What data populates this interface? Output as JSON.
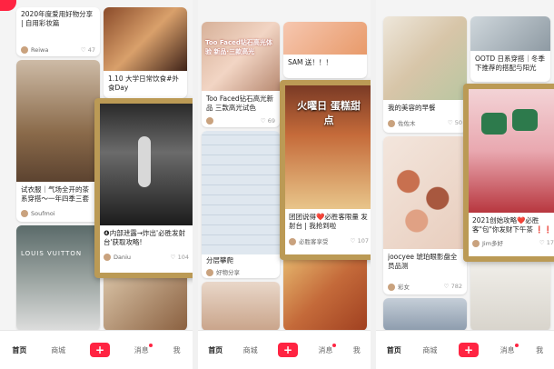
{
  "phone1": {
    "cards": [
      {
        "title": "2020年度爱用好物分享 | 自用彩妆篇",
        "user": "Reiwa",
        "likes": "47"
      },
      {
        "title": "1.10 大学日常饮食#外食Day",
        "user": "",
        "likes": ""
      },
      {
        "title": "试衣服｜气场全开的茶系穿搭～一年四季三套",
        "user": "Soufmoi",
        "likes": ""
      },
      {
        "title": "LOUIS VUITTON",
        "user": "",
        "likes": ""
      }
    ],
    "featured": {
      "title": "❹内部泄露→炸出'必胜发射台'获取攻略!",
      "user": "Daniu",
      "likes": "104"
    },
    "tabbar": {
      "home": "首页",
      "mall": "商城",
      "plus": "+",
      "msg": "消息",
      "me": "我"
    }
  },
  "phone2": {
    "cards": [
      {
        "title": "Too Faced钻石高光体验 新品·三款高光",
        "user": "",
        "likes": "69"
      },
      {
        "title": "Too Faced钻石高光新品 三款高光试色",
        "user": "",
        "likes": "69"
      },
      {
        "title": "SAM 送！！！",
        "user": "",
        "likes": ""
      },
      {
        "title": "分层攀爬",
        "user": "好物分享",
        "likes": ""
      }
    ],
    "featured": {
      "banner": "火曜日 蛋糕甜点",
      "title": "团团说得❤️必胜客限量 发射台 | 我抢到啦",
      "user": "必胜客享受",
      "likes": "107"
    },
    "tabbar": {
      "home": "首页",
      "mall": "商城",
      "plus": "+",
      "msg": "消息",
      "me": "我"
    }
  },
  "phone3": {
    "cards": [
      {
        "title": "我的美容的早餐",
        "user": "佐佐木",
        "likes": "50"
      },
      {
        "title": "joocyee 琥珀眼影盘全员品测",
        "user": "彩女",
        "likes": "782"
      },
      {
        "title": "OOTD 日系穿搭｜冬季下推荐的搭配与阳光",
        "user": "",
        "likes": ""
      }
    ],
    "featured": {
      "title": "2021创始攻略❤️必胜客\"包\"你发财下午茶 ❗❗",
      "user": "Jim多好",
      "likes": "17"
    },
    "tabbar": {
      "home": "首页",
      "mall": "商城",
      "plus": "+",
      "msg": "消息",
      "me": "我"
    }
  }
}
